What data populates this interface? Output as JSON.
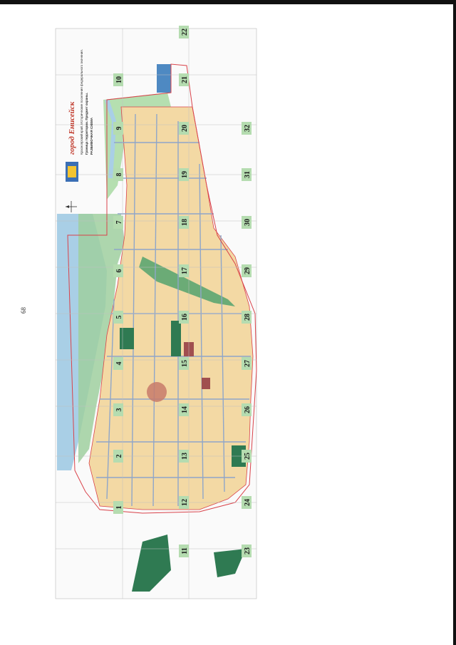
{
  "page_number": "68",
  "map": {
    "title": "город Енисейск",
    "subtitle_line1": "Красноярский край. Исторические поселения федерального значения.",
    "subtitle_line2": "Граница территории. Предмет охраны.",
    "subtitle_line3": "РАЗБИВОЧНАЯ СХЕМА",
    "sheet_numbers": [
      "1",
      "2",
      "3",
      "4",
      "5",
      "6",
      "7",
      "8",
      "9",
      "10",
      "11",
      "12",
      "13",
      "14",
      "15",
      "16",
      "17",
      "18",
      "19",
      "20",
      "21",
      "22",
      "23",
      "24",
      "25",
      "26",
      "27",
      "28",
      "29",
      "30",
      "31",
      "32"
    ],
    "colors": {
      "river": "#a9cfe6",
      "park": "#2f7a52",
      "park_light": "#9fcf9f",
      "blocks": "#f3d9a4",
      "streets": "#8fa6c9",
      "boundary": "#d9424a",
      "label_bg": "#b5dcb0"
    }
  }
}
